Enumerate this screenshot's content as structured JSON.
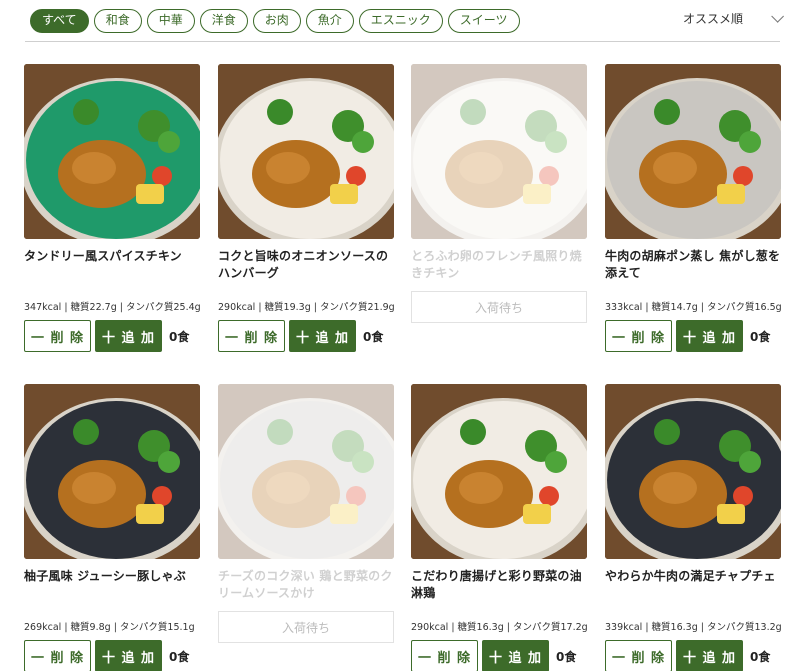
{
  "filters": [
    {
      "label": "すべて",
      "active": true
    },
    {
      "label": "和食",
      "active": false
    },
    {
      "label": "中華",
      "active": false
    },
    {
      "label": "洋食",
      "active": false
    },
    {
      "label": "お肉",
      "active": false
    },
    {
      "label": "魚介",
      "active": false
    },
    {
      "label": "エスニック",
      "active": false
    },
    {
      "label": "スイーツ",
      "active": false
    }
  ],
  "sort": {
    "label": "オススメ順"
  },
  "colors": {
    "accent": "#3d6b2a"
  },
  "products": [
    {
      "name": "タンドリー風スパイスチキン",
      "nutrition": "347kcal | 糖質22.7g | タンパク質25.4g",
      "minus": "一 削 除",
      "plus": "十 追 加",
      "qty": "0食",
      "available": true,
      "plate": "green"
    },
    {
      "name": "コクと旨味のオニオンソースのハンバーグ",
      "nutrition": "290kcal | 糖質19.3g | タンパク質21.9g",
      "minus": "一 削 除",
      "plus": "十 追 加",
      "qty": "0食",
      "available": true,
      "plate": "white"
    },
    {
      "name": "とろふわ卵のフレンチ風照り焼きチキン",
      "nutrition": "",
      "wait": "入荷待ち",
      "available": false,
      "plate": "white"
    },
    {
      "name": "牛肉の胡麻ポン蒸し 焦がし葱を添えて",
      "nutrition": "333kcal | 糖質14.7g | タンパク質16.5g",
      "minus": "一 削 除",
      "plus": "十 追 加",
      "qty": "0食",
      "available": true,
      "plate": "gray"
    },
    {
      "name": "柚子風味 ジューシー豚しゃぶ",
      "nutrition": "269kcal | 糖質9.8g | タンパク質15.1g",
      "minus": "一 削 除",
      "plus": "十 追 加",
      "qty": "0食",
      "available": true,
      "plate": "dark"
    },
    {
      "name": "チーズのコク深い 鶏と野菜のクリームソースかけ",
      "nutrition": "",
      "wait": "入荷待ち",
      "available": false,
      "plate": "gray"
    },
    {
      "name": "こだわり唐揚げと彩り野菜の油淋鶏",
      "nutrition": "290kcal | 糖質16.3g | タンパク質17.2g",
      "minus": "一 削 除",
      "plus": "十 追 加",
      "qty": "0食",
      "available": true,
      "plate": "white"
    },
    {
      "name": "やわらか牛肉の満足チャプチェ",
      "nutrition": "339kcal | 糖質16.3g | タンパク質13.2g",
      "minus": "一 削 除",
      "plus": "十 追 加",
      "qty": "0食",
      "available": true,
      "plate": "dark"
    }
  ]
}
